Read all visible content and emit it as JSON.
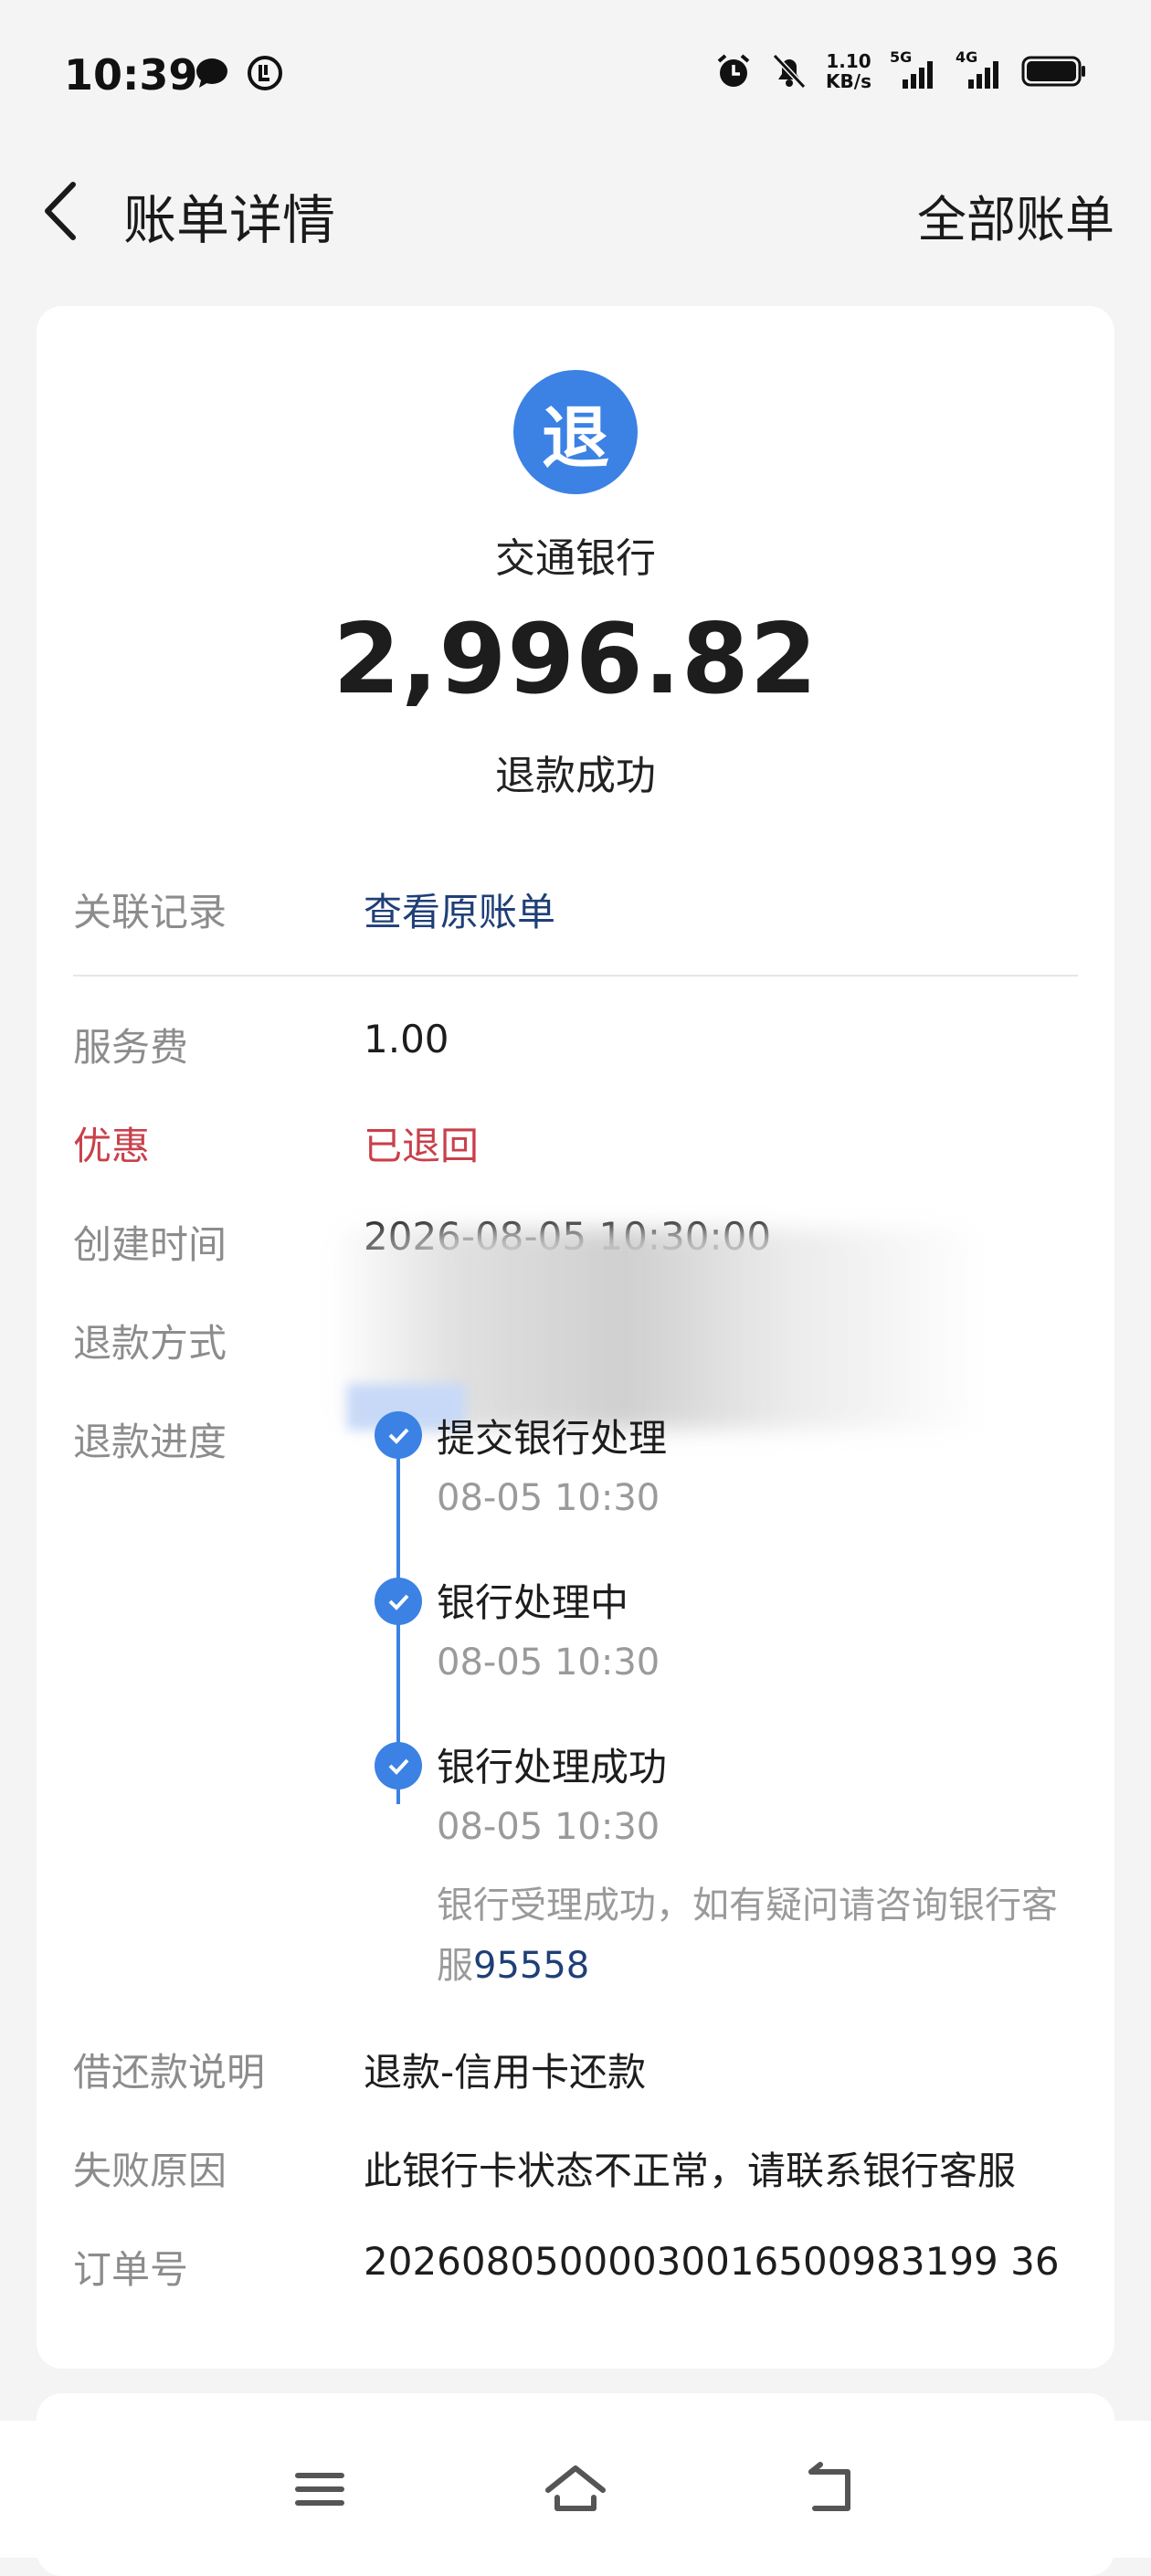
{
  "status_bar": {
    "time": "10:39",
    "net_speed_value": "1.10",
    "net_speed_unit": "KB/s",
    "sig1_label": "5G",
    "sig2_label": "4G"
  },
  "header": {
    "title": "账单详情",
    "all_bills": "全部账单"
  },
  "summary": {
    "badge": "退",
    "merchant": "交通银行",
    "amount": "2,996.82",
    "status": "退款成功"
  },
  "details": {
    "related_label": "关联记录",
    "related_value": "查看原账单",
    "fee_label": "服务费",
    "fee_value": "1.00",
    "discount_label": "优惠",
    "discount_value": "已退回",
    "created_label": "创建时间",
    "created_value": "2026-08-05 10:30:00",
    "method_label": "退款方式",
    "progress_label": "退款进度",
    "note_label": "借还款说明",
    "note_value": "退款-信用卡还款",
    "fail_label": "失败原因",
    "fail_value": "此银行卡状态不正常，请联系银行客服",
    "order_label": "订单号",
    "order_value": "20260805000030016500983199 36"
  },
  "timeline": [
    {
      "title": "提交银行处理",
      "time": "08-05 10:30"
    },
    {
      "title": "银行处理中",
      "time": "08-05 10:30"
    },
    {
      "title": "银行处理成功",
      "time": "08-05 10:30"
    }
  ],
  "timeline_note": {
    "text": "银行受理成功，如有疑问请咨询银行客服",
    "phone": "95558"
  },
  "colors": {
    "accent_blue": "#3b82e4",
    "link_blue": "#1f3f77",
    "warning_red": "#c9404a"
  }
}
